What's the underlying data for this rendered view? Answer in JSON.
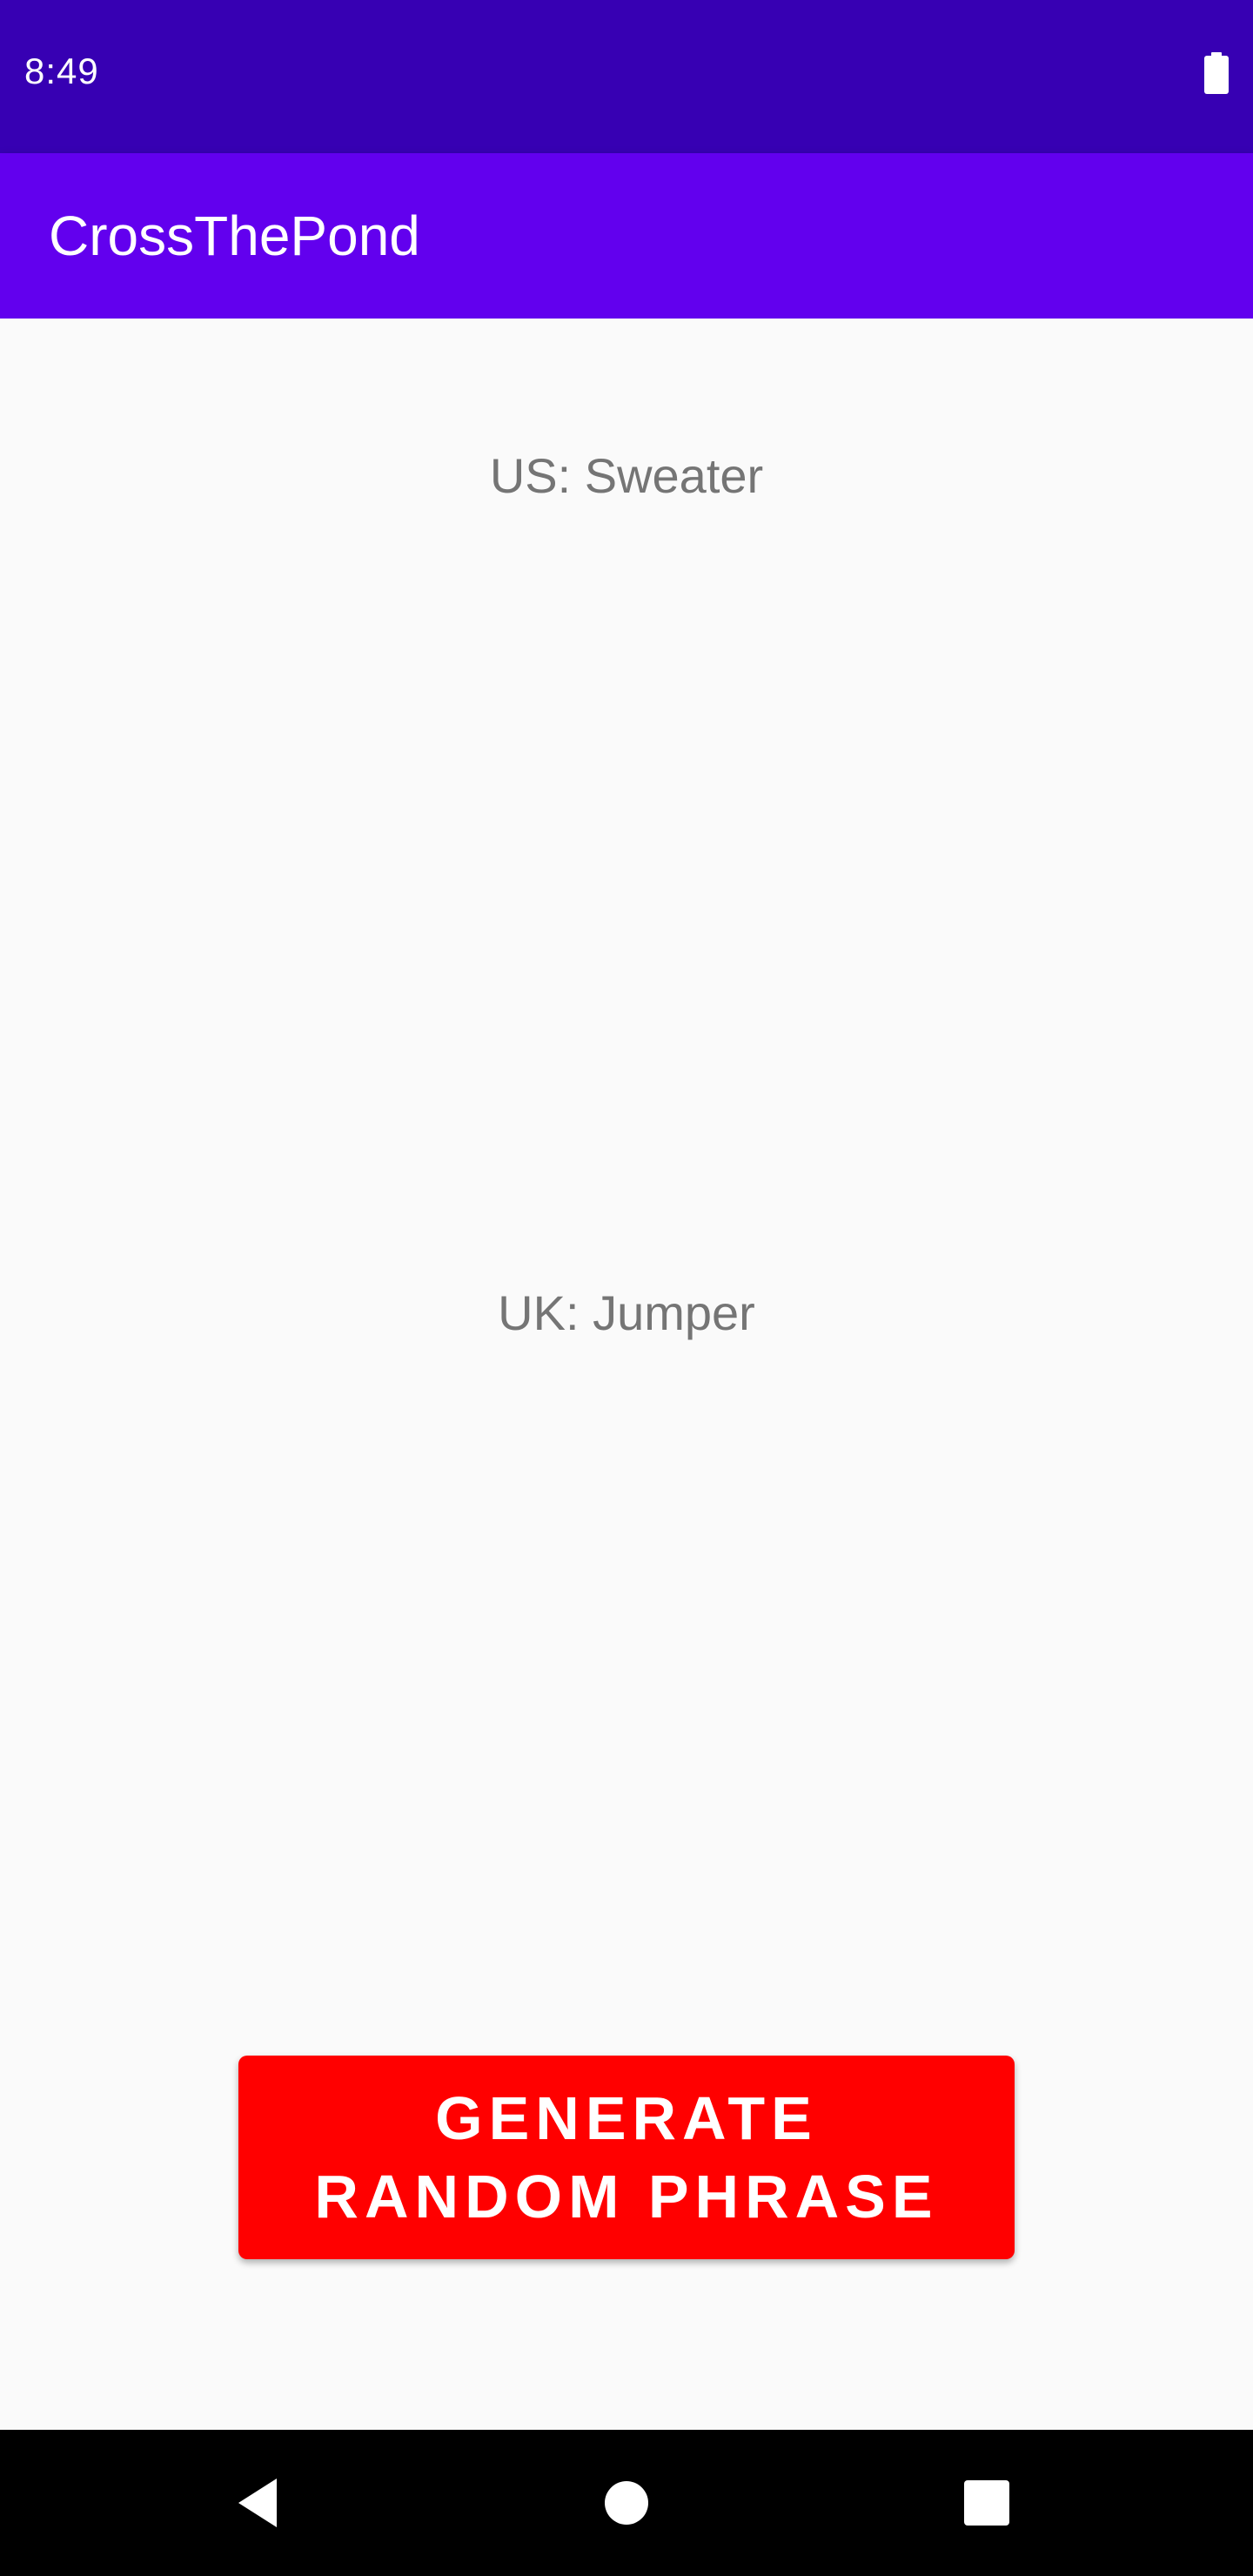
{
  "status_bar": {
    "time": "8:49",
    "battery_icon": "battery-full-icon"
  },
  "app_bar": {
    "title": "CrossThePond"
  },
  "main": {
    "us_phrase": "US: Sweater",
    "uk_phrase": "UK: Jumper",
    "generate_button": {
      "line1": "GENERATE",
      "line2": "RANDOM PHRASE"
    }
  },
  "nav_bar": {
    "back_icon": "back-triangle-icon",
    "home_icon": "home-circle-icon",
    "recents_icon": "recents-square-icon"
  },
  "colors": {
    "status_bar": "#3700b3",
    "app_bar": "#6200ee",
    "button": "#ff0000",
    "phrase_text": "#757575",
    "background": "#fafafa"
  }
}
